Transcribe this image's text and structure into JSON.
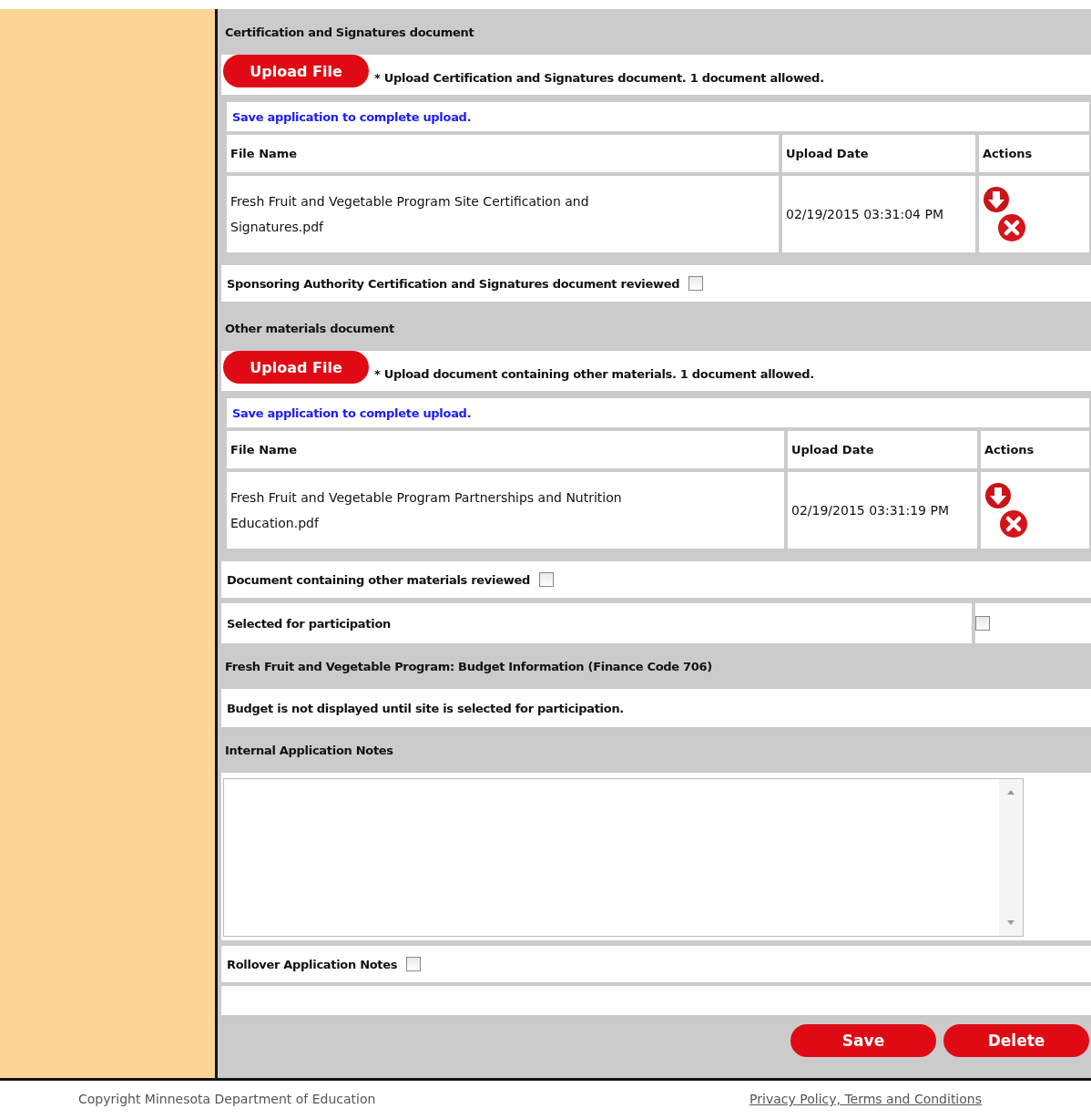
{
  "documents": [
    {
      "header": "Certification and Signatures document",
      "upload_button": "Upload File",
      "instruction": "* Upload Certification and Signatures document. 1 document allowed.",
      "save_note": "Save application to complete upload.",
      "columns": [
        "File Name",
        "Upload Date",
        "Actions"
      ],
      "rows": [
        {
          "file_name": "Fresh Fruit and Vegetable Program Site Certification and Signatures.pdf",
          "upload_date": "02/19/2015 03:31:04 PM"
        }
      ],
      "review": {
        "label": "Sponsoring Authority Certification and Signatures document reviewed",
        "checked": false
      }
    },
    {
      "header": "Other materials document",
      "upload_button": "Upload File",
      "instruction": "* Upload document containing other materials. 1 document allowed.",
      "save_note": "Save application to complete upload.",
      "columns": [
        "File Name",
        "Upload Date",
        "Actions"
      ],
      "rows": [
        {
          "file_name": "Fresh Fruit and Vegetable Program Partnerships and Nutrition Education.pdf",
          "upload_date": "02/19/2015 03:31:19 PM"
        }
      ],
      "review": {
        "label": "Document containing other materials reviewed",
        "checked": false
      }
    }
  ],
  "participation": {
    "label": "Selected for participation",
    "checked": false
  },
  "budget": {
    "header": "Fresh Fruit and Vegetable Program: Budget Information (Finance Code 706)",
    "note": "Budget is not displayed until site is selected for participation."
  },
  "notes": {
    "header": "Internal Application Notes",
    "rollover": {
      "label": "Rollover Application Notes",
      "checked": false
    }
  },
  "buttons": [
    "Save",
    "Delete"
  ],
  "footer": {
    "copyright": "Copyright Minnesota Department of Education",
    "link": "Privacy Policy, Terms and Conditions"
  }
}
